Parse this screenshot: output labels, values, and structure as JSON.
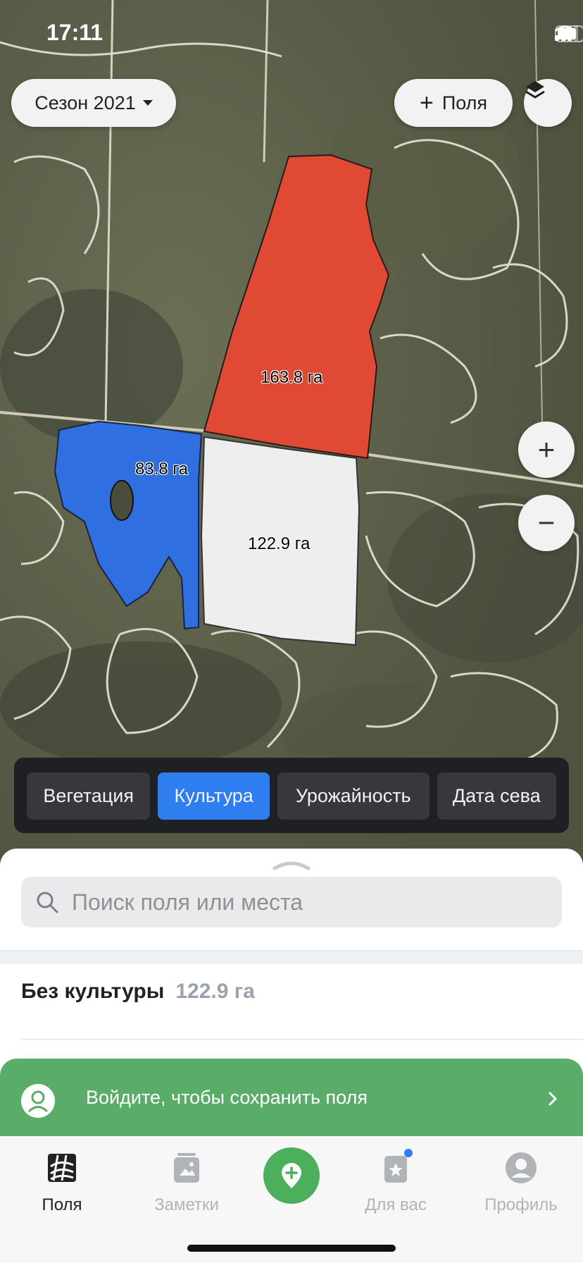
{
  "status_bar": {
    "time": "17:11"
  },
  "map": {
    "season_label": "Сезон 2021",
    "add_field_label": "Поля",
    "fields": [
      {
        "area_label": "163.8 га",
        "color": "#e04a35"
      },
      {
        "area_label": "83.8 га",
        "color": "#2f6fe0"
      },
      {
        "area_label": "122.9 га",
        "color": "#eeeeee"
      }
    ]
  },
  "modes": [
    {
      "label": "Вегетация",
      "active": false
    },
    {
      "label": "Культура",
      "active": true
    },
    {
      "label": "Урожайность",
      "active": false
    },
    {
      "label": "Дата сева",
      "active": false
    }
  ],
  "sheet": {
    "search_placeholder": "Поиск поля или места",
    "crop_group": {
      "name": "Без культуры",
      "area": "122.9 га"
    }
  },
  "banner": {
    "text": "Войдите, чтобы сохранить поля"
  },
  "tabs": [
    {
      "label": "Поля",
      "icon": "fields-icon",
      "active": true
    },
    {
      "label": "Заметки",
      "icon": "notes-icon",
      "active": false
    },
    {
      "label": "Для вас",
      "icon": "for-you-icon",
      "active": false
    },
    {
      "label": "Профиль",
      "icon": "profile-icon",
      "active": false
    }
  ],
  "colors": {
    "accent": "#2e7ef0",
    "green": "#5aad69"
  }
}
